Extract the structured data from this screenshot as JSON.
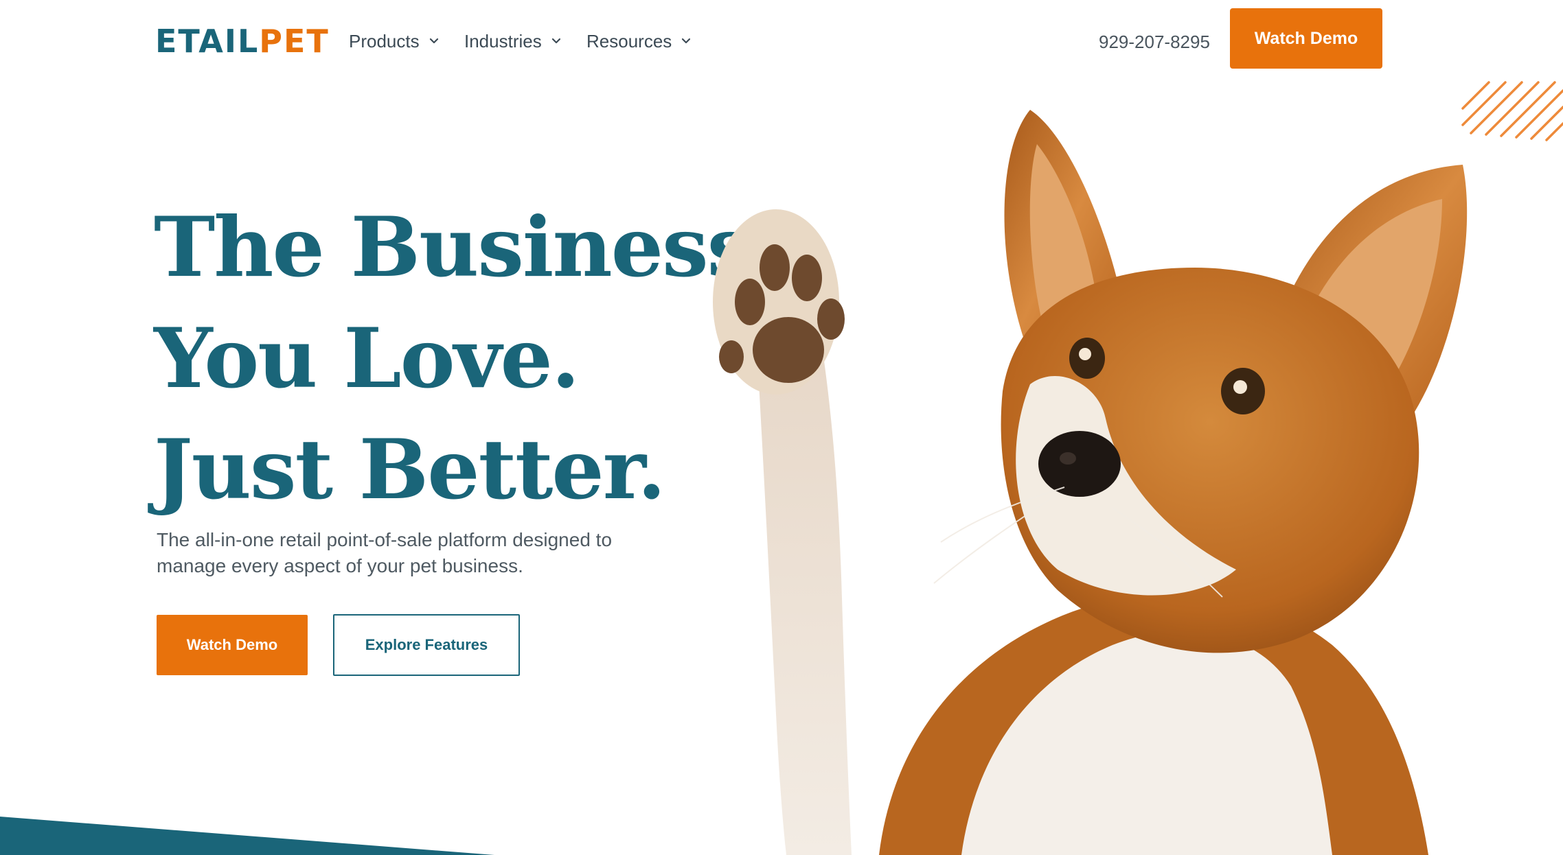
{
  "brand": {
    "logo_part1": "ETAIL",
    "logo_part2": "PET",
    "primary_color": "#1a6579",
    "accent_color": "#e8720c"
  },
  "nav": {
    "items": [
      {
        "label": "Products",
        "icon": "chevron-down-icon"
      },
      {
        "label": "Industries",
        "icon": "chevron-down-icon"
      },
      {
        "label": "Resources",
        "icon": "chevron-down-icon"
      }
    ],
    "phone": "929-207-8295",
    "cta_label": "Watch Demo"
  },
  "hero": {
    "title_lines": [
      "The Business",
      "You Love.",
      "Just Better."
    ],
    "subtitle": "The all-in-one retail point-of-sale platform designed to manage every aspect of your pet business.",
    "primary_cta": "Watch Demo",
    "secondary_cta": "Explore Features"
  }
}
